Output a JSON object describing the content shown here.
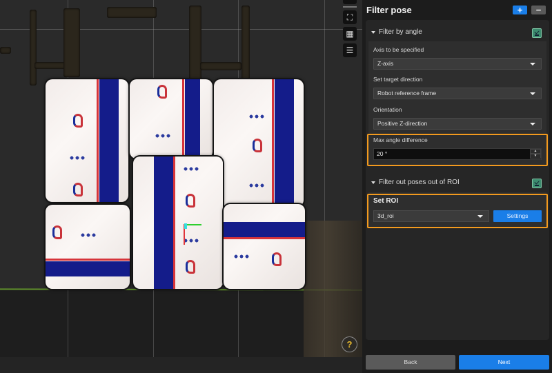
{
  "viewport": {
    "tools": [
      {
        "name": "fit-view",
        "icon": "fit-view-icon",
        "glyph": "⛶"
      },
      {
        "name": "grid-plane",
        "icon": "grid-plane-icon",
        "glyph": "▦"
      },
      {
        "name": "display-list",
        "icon": "list-icon",
        "glyph": "☰"
      }
    ],
    "help_glyph": "?"
  },
  "panel": {
    "title": "Filter pose",
    "add_glyph": "+",
    "remove_glyph": "−",
    "sections": {
      "angle": {
        "label": "Filter by angle",
        "axis_label": "Axis to be specified",
        "axis_value": "Z-axis",
        "direction_label": "Set target direction",
        "direction_value": "Robot reference frame",
        "orientation_label": "Orientation",
        "orientation_value": "Positive Z-direction",
        "max_angle_label": "Max angle difference",
        "max_angle_value": "20 °",
        "spin_up": "▲",
        "spin_down": "▼"
      },
      "roi": {
        "label": "Filter out poses out of ROI",
        "set_roi_label": "Set ROI",
        "roi_value": "3d_roi",
        "settings_label": "Settings"
      }
    },
    "footer": {
      "back_label": "Back",
      "next_label": "Next"
    }
  },
  "colors": {
    "accent_blue": "#1a7ee8",
    "highlight_orange": "#f39a1e",
    "section_icon_green": "#3d8c6f"
  }
}
